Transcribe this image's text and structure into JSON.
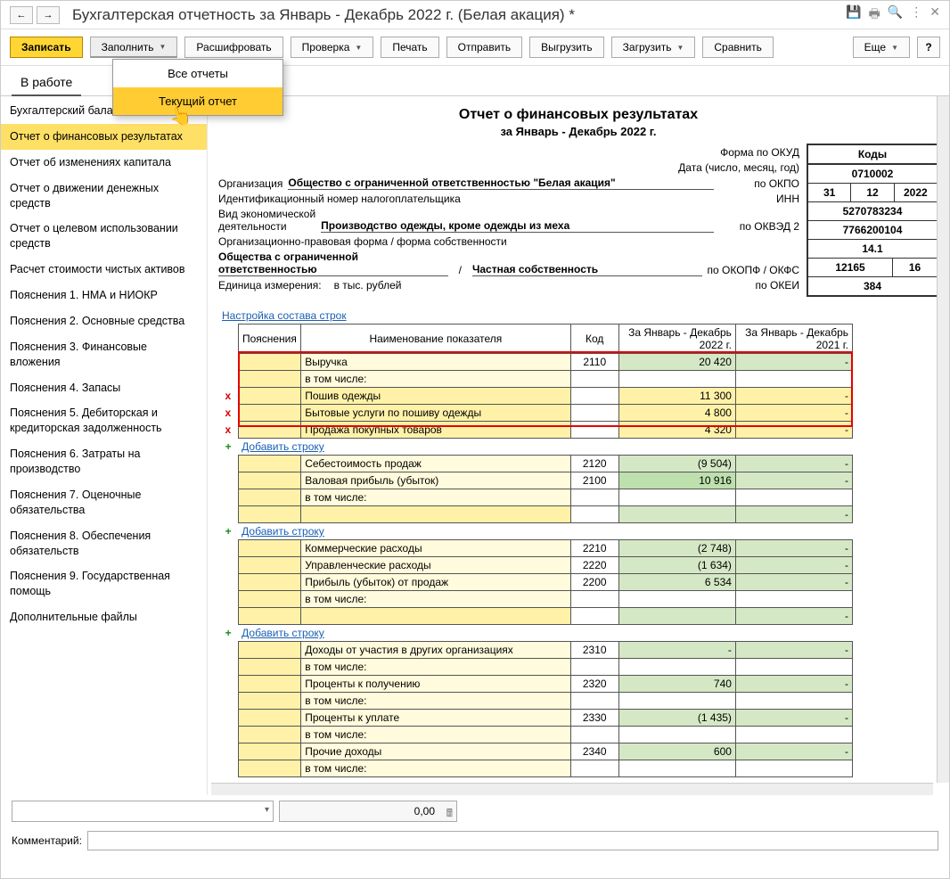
{
  "window_title": "Бухгалтерская отчетность за Январь - Декабрь 2022 г. (Белая акация) *",
  "toolbar": {
    "write": "Записать",
    "fill": "Заполнить",
    "decipher": "Расшифровать",
    "check": "Проверка",
    "print": "Печать",
    "send": "Отправить",
    "upload": "Выгрузить",
    "download": "Загрузить",
    "compare": "Сравнить",
    "more": "Еще",
    "help": "?"
  },
  "dropdown": {
    "item1": "Все отчеты",
    "item2": "Текущий отчет"
  },
  "tab_active": "В работе",
  "sidebar": [
    "Бухгалтерский баланс",
    "Отчет о финансовых результатах",
    "Отчет об изменениях капитала",
    "Отчет о движении денежных средств",
    "Отчет о целевом использовании средств",
    "Расчет стоимости чистых активов",
    "Пояснения 1. НМА и НИОКР",
    "Пояснения 2. Основные средства",
    "Пояснения 3. Финансовые вложения",
    "Пояснения 4. Запасы",
    "Пояснения 5. Дебиторская и кредиторская задолженность",
    "Пояснения 6. Затраты на производство",
    "Пояснения 7. Оценочные обязательства",
    "Пояснения 8. Обеспечения обязательств",
    "Пояснения 9. Государственная помощь",
    "Дополнительные файлы"
  ],
  "report": {
    "title": "Отчет о финансовых результатах",
    "period": "за Январь - Декабрь 2022 г.",
    "form_okud_label": "Форма по ОКУД",
    "date_label": "Дата (число, месяц, год)",
    "org_label": "Организация",
    "org_val": "Общество с ограниченной ответственностью \"Белая акация\"",
    "okpo_label": "по ОКПО",
    "inn_label_long": "Идентификационный номер налогоплательщика",
    "inn_label": "ИНН",
    "activity_label1": "Вид экономической",
    "activity_label2": "деятельности",
    "activity_val": "Производство одежды, кроме одежды из меха",
    "okved_label": "по ОКВЭД 2",
    "opf_label": "Организационно-правовая форма / форма собственности",
    "opf_val1": "Общества с ограниченной ответственностью",
    "opf_val2": "Частная собственность",
    "okopf_label": "по ОКОПФ / ОКФС",
    "unit_label": "Единица измерения:",
    "unit_val": "в тыс. рублей",
    "okei_label": "по ОКЕИ",
    "codes_head": "Коды",
    "code_okud": "0710002",
    "code_day": "31",
    "code_month": "12",
    "code_year": "2022",
    "code_okpo": "5270783234",
    "code_inn": "7766200104",
    "code_okved": "14.1",
    "code_okopf": "12165",
    "code_okfs": "16",
    "code_okei": "384",
    "cfg_link": "Настройка состава строк",
    "hdr_poy": "Пояснения",
    "hdr_name": "Наименование показателя",
    "hdr_code": "Код",
    "hdr_cur": "За Январь - Декабрь 2022 г.",
    "hdr_prev": "За Январь - Декабрь 2021 г.",
    "add_row": "Добавить строку",
    "rows": {
      "r1": {
        "name": "Выручка",
        "code": "2110",
        "v1": "20 420",
        "v2": "-"
      },
      "r2": {
        "name": "в том числе:"
      },
      "r3": {
        "name": "Пошив одежды",
        "v1": "11 300",
        "v2": "-"
      },
      "r4": {
        "name": "Бытовые услуги по пошиву одежды",
        "v1": "4 800",
        "v2": "-"
      },
      "r5": {
        "name": "Продажа покупных товаров",
        "v1": "4 320",
        "v2": "-"
      },
      "r6": {
        "name": "Себестоимость продаж",
        "code": "2120",
        "v1": "(9 504)",
        "v2": "-"
      },
      "r7": {
        "name": "Валовая прибыль (убыток)",
        "code": "2100",
        "v1": "10 916",
        "v2": "-"
      },
      "r8": {
        "name": "в том числе:"
      },
      "r9": {
        "v2": "-"
      },
      "r10": {
        "name": "Коммерческие расходы",
        "code": "2210",
        "v1": "(2 748)",
        "v2": "-"
      },
      "r11": {
        "name": "Управленческие расходы",
        "code": "2220",
        "v1": "(1 634)",
        "v2": "-"
      },
      "r12": {
        "name": "Прибыль (убыток) от продаж",
        "code": "2200",
        "v1": "6 534",
        "v2": "-"
      },
      "r13": {
        "name": "в том числе:"
      },
      "r14": {
        "v2": "-"
      },
      "r15": {
        "name": "Доходы от участия в других организациях",
        "code": "2310",
        "v1": "-",
        "v2": "-"
      },
      "r16": {
        "name": "в том числе:"
      },
      "r17": {
        "name": "Проценты к получению",
        "code": "2320",
        "v1": "740",
        "v2": "-"
      },
      "r18": {
        "name": "в том числе:"
      },
      "r19": {
        "name": "Проценты к уплате",
        "code": "2330",
        "v1": "(1 435)",
        "v2": "-"
      },
      "r20": {
        "name": "в том числе:"
      },
      "r21": {
        "name": "Прочие доходы",
        "code": "2340",
        "v1": "600",
        "v2": "-"
      },
      "r22": {
        "name": "в том числе:"
      }
    }
  },
  "footer": {
    "amount": "0,00",
    "comment_label": "Комментарий:"
  }
}
